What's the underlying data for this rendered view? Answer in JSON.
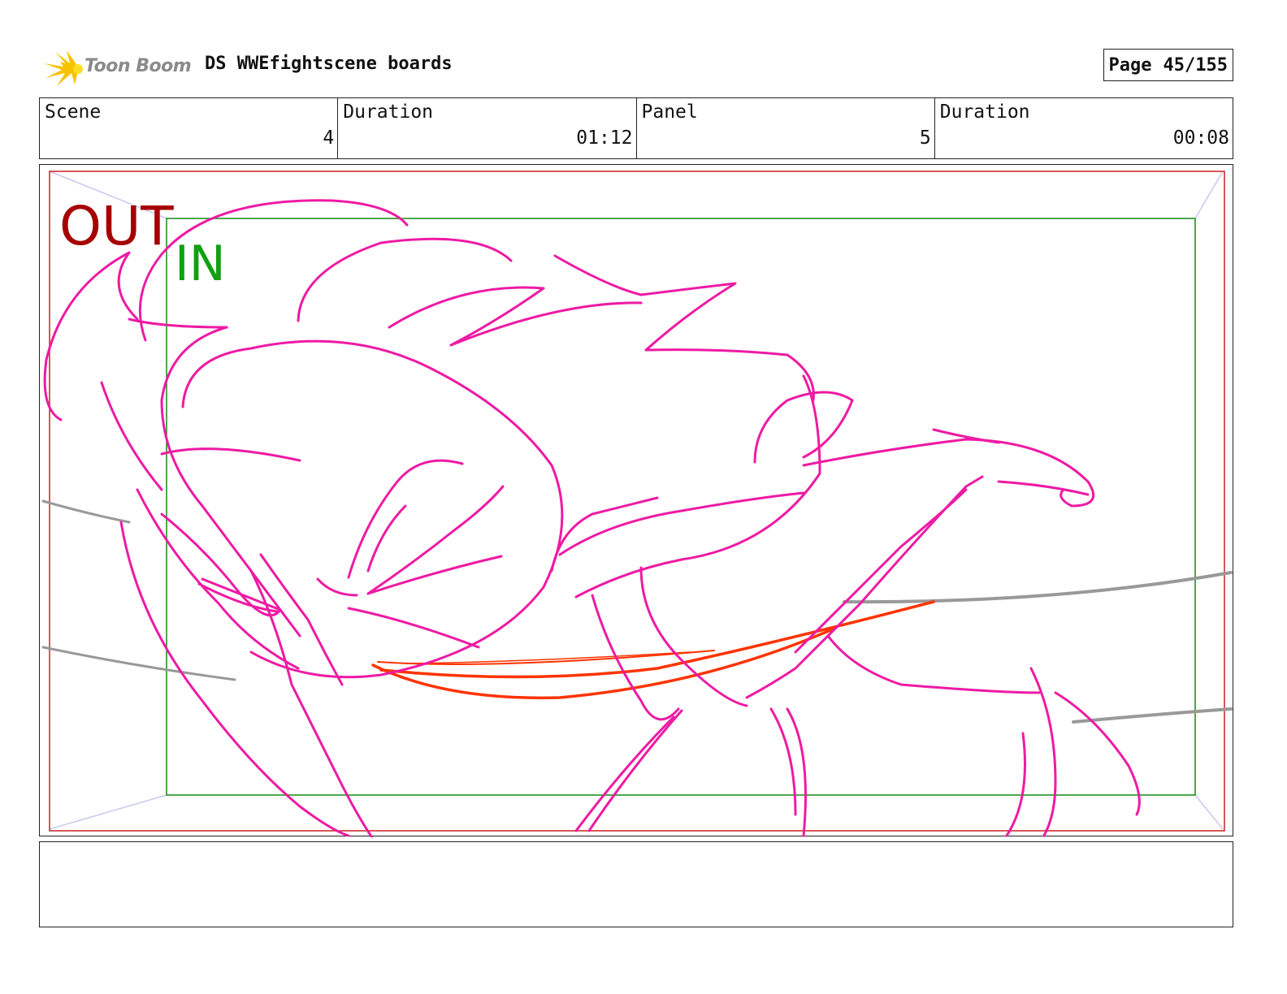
{
  "header": {
    "logo_text": "Toon Boom",
    "title": "DS WWEfightscene boards",
    "page_label": "Page",
    "page_value": "45/155"
  },
  "info": [
    {
      "label": "Scene",
      "value": "4"
    },
    {
      "label": "Duration",
      "value": "01:12"
    },
    {
      "label": "Panel",
      "value": "5"
    },
    {
      "label": "Duration",
      "value": "00:08"
    }
  ],
  "frame": {
    "out_label": "OUT",
    "in_label": "IN"
  },
  "colors": {
    "out": "#a50000",
    "in": "#10a010",
    "sketch": "#ee1aa4",
    "motion": "#ff3300",
    "ropes": "#999999"
  },
  "notes": {
    "text": ""
  }
}
